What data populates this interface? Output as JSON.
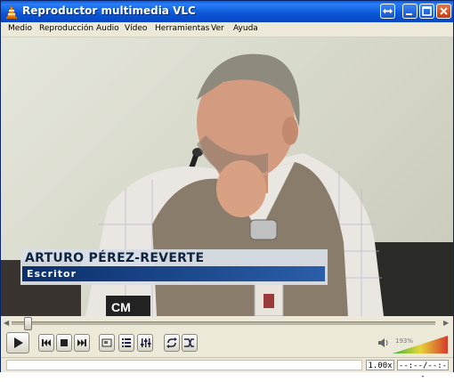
{
  "window": {
    "title": "Reproductor multimedia VLC"
  },
  "menu": [
    "Medio",
    "Reproducción",
    "Audio",
    "Vídeo",
    "Herramientas",
    "Ver",
    "Ayuda"
  ],
  "video": {
    "caption_name": "ARTURO PÉREZ-REVERTE",
    "caption_role": "Escritor"
  },
  "controls": {
    "volume_percent": "193%",
    "seek_progress": 0.03
  },
  "status": {
    "speed": "1.00x",
    "time": "--:--/--:--"
  },
  "colors": {
    "titlebar": "#0a56d6",
    "caption_bar": "#0b2f6b",
    "chrome": "#ece9d8"
  }
}
